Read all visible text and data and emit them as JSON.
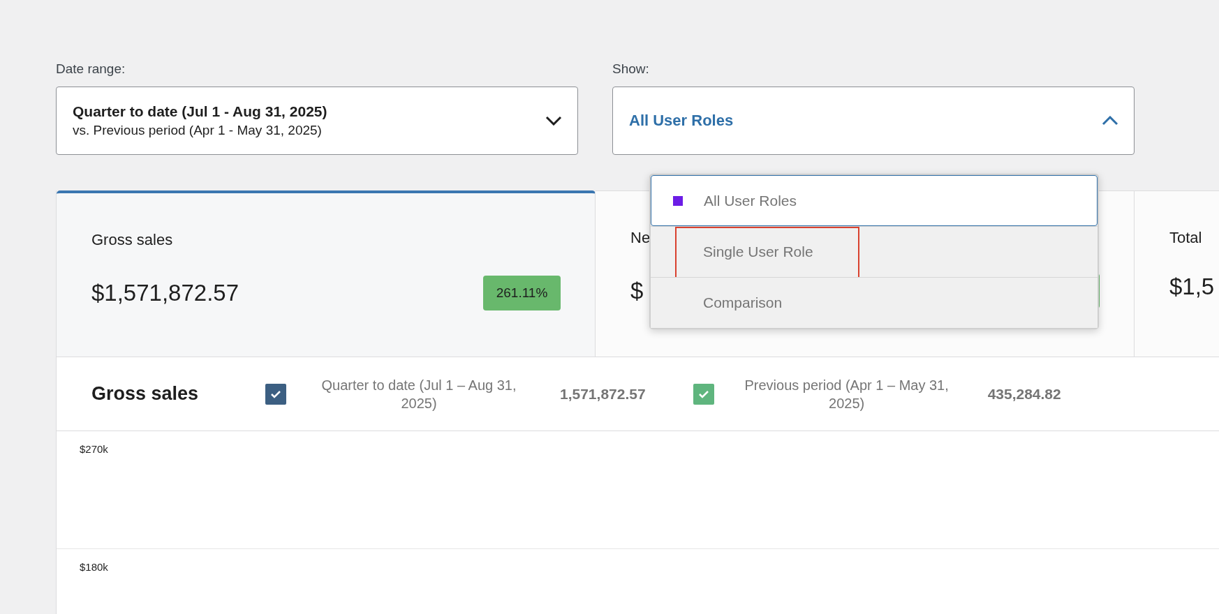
{
  "filters": [
    {
      "kind": "date",
      "label": "Date range:",
      "value": "Quarter to date (Jul 1 - Aug 31, 2025)",
      "secondary": "vs. Previous period (Apr 1 - May 31, 2025)",
      "expanded": false
    },
    {
      "kind": "select",
      "label": "Show:",
      "value": "All User Roles",
      "expanded": true,
      "options": [
        {
          "label": "All User Roles",
          "selected": true,
          "color": "#6c1de6",
          "highlighted": false
        },
        {
          "label": "Single User Role",
          "selected": false,
          "highlighted": true
        },
        {
          "label": "Comparison",
          "selected": false,
          "highlighted": false
        }
      ]
    }
  ],
  "cards": [
    {
      "title": "Gross sales",
      "value": "$1,571,872.57",
      "change": "261.11%",
      "positive": true,
      "selected": true
    },
    {
      "title": "Ne",
      "value": "$",
      "positive": true,
      "selected": false
    },
    {
      "title": "Total",
      "value": "$1,5",
      "selected": false
    }
  ],
  "legend": {
    "title": "Gross sales",
    "series": [
      {
        "label": "Quarter to date (Jul 1 – Aug 31, 2025)",
        "value": "1,571,872.57",
        "checked": true,
        "color": "#3c5f82"
      },
      {
        "label": "Previous period (Apr 1 – May 31, 2025)",
        "value": "435,284.82",
        "checked": true,
        "color": "#5fb57e"
      }
    ]
  },
  "chart": {
    "y_axis_labels": [
      "$270k",
      "$180k"
    ]
  }
}
